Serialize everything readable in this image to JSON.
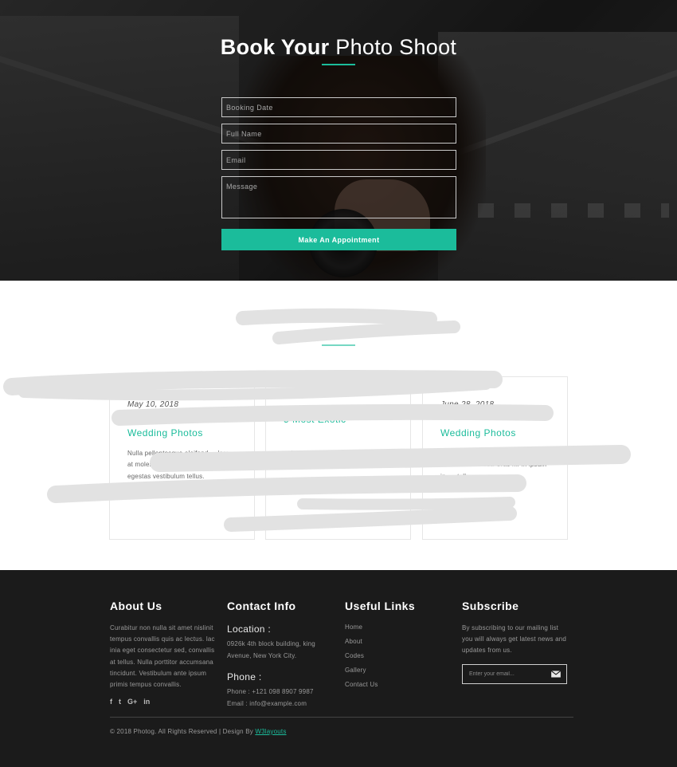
{
  "hero": {
    "title_bold": "Book Your",
    "title_light": "Photo Shoot",
    "form": {
      "booking_date_placeholder": "Booking Date",
      "full_name_placeholder": "Full Name",
      "email_placeholder": "Email",
      "message_placeholder": "Message",
      "submit_label": "Make An Appointment"
    }
  },
  "blog": {
    "cards": [
      {
        "date": "May 10, 2018",
        "title": "Wedding Photos",
        "text": "Nulla pellentesque eleifend ... lorem, at molestie arcu pulvinar ut. ... egestas vestibulum tellus."
      },
      {
        "date": "",
        "title": "5 Most Exotic",
        "text": "... lorem, at molestie arcu pulvinar ut. ... egestas"
      },
      {
        "date": "June 28, 2018",
        "title": "Wedding Photos",
        "text": "eleifend. Integer ... pulvinar ut. Proin ac fermentum est. Cras mi ... ipsum in, ... tellus."
      }
    ]
  },
  "footer": {
    "about": {
      "heading": "About Us",
      "text": "Curabitur non nulla sit amet nislinit tempus convallis quis ac lectus. lac inia eget consectetur sed, convallis at tellus. Nulla porttitor accumsana tincidunt. Vestibulum ante ipsum primis tempus convallis.",
      "social": [
        "f",
        "t",
        "G+",
        "in"
      ]
    },
    "contact": {
      "heading": "Contact Info",
      "location_label": "Location :",
      "location_text": "0926k 4th block building, king Avenue, New York City.",
      "phone_label": "Phone :",
      "phone_text": "Phone : +121 098 8907 9987",
      "email_text": "Email : info@example.com"
    },
    "links": {
      "heading": "Useful Links",
      "items": [
        "Home",
        "About",
        "Codes",
        "Gallery",
        "Contact Us"
      ]
    },
    "subscribe": {
      "heading": "Subscribe",
      "text": "By subscribing to our mailing list you will always get latest news and updates from us.",
      "placeholder": "Enter your email..."
    },
    "copyright_text": "© 2018 Photog. All Rights Reserved | Design By",
    "copyright_link": "W3layouts"
  },
  "colors": {
    "accent": "#1bbc9b",
    "footer_bg": "#1b1b1b"
  }
}
